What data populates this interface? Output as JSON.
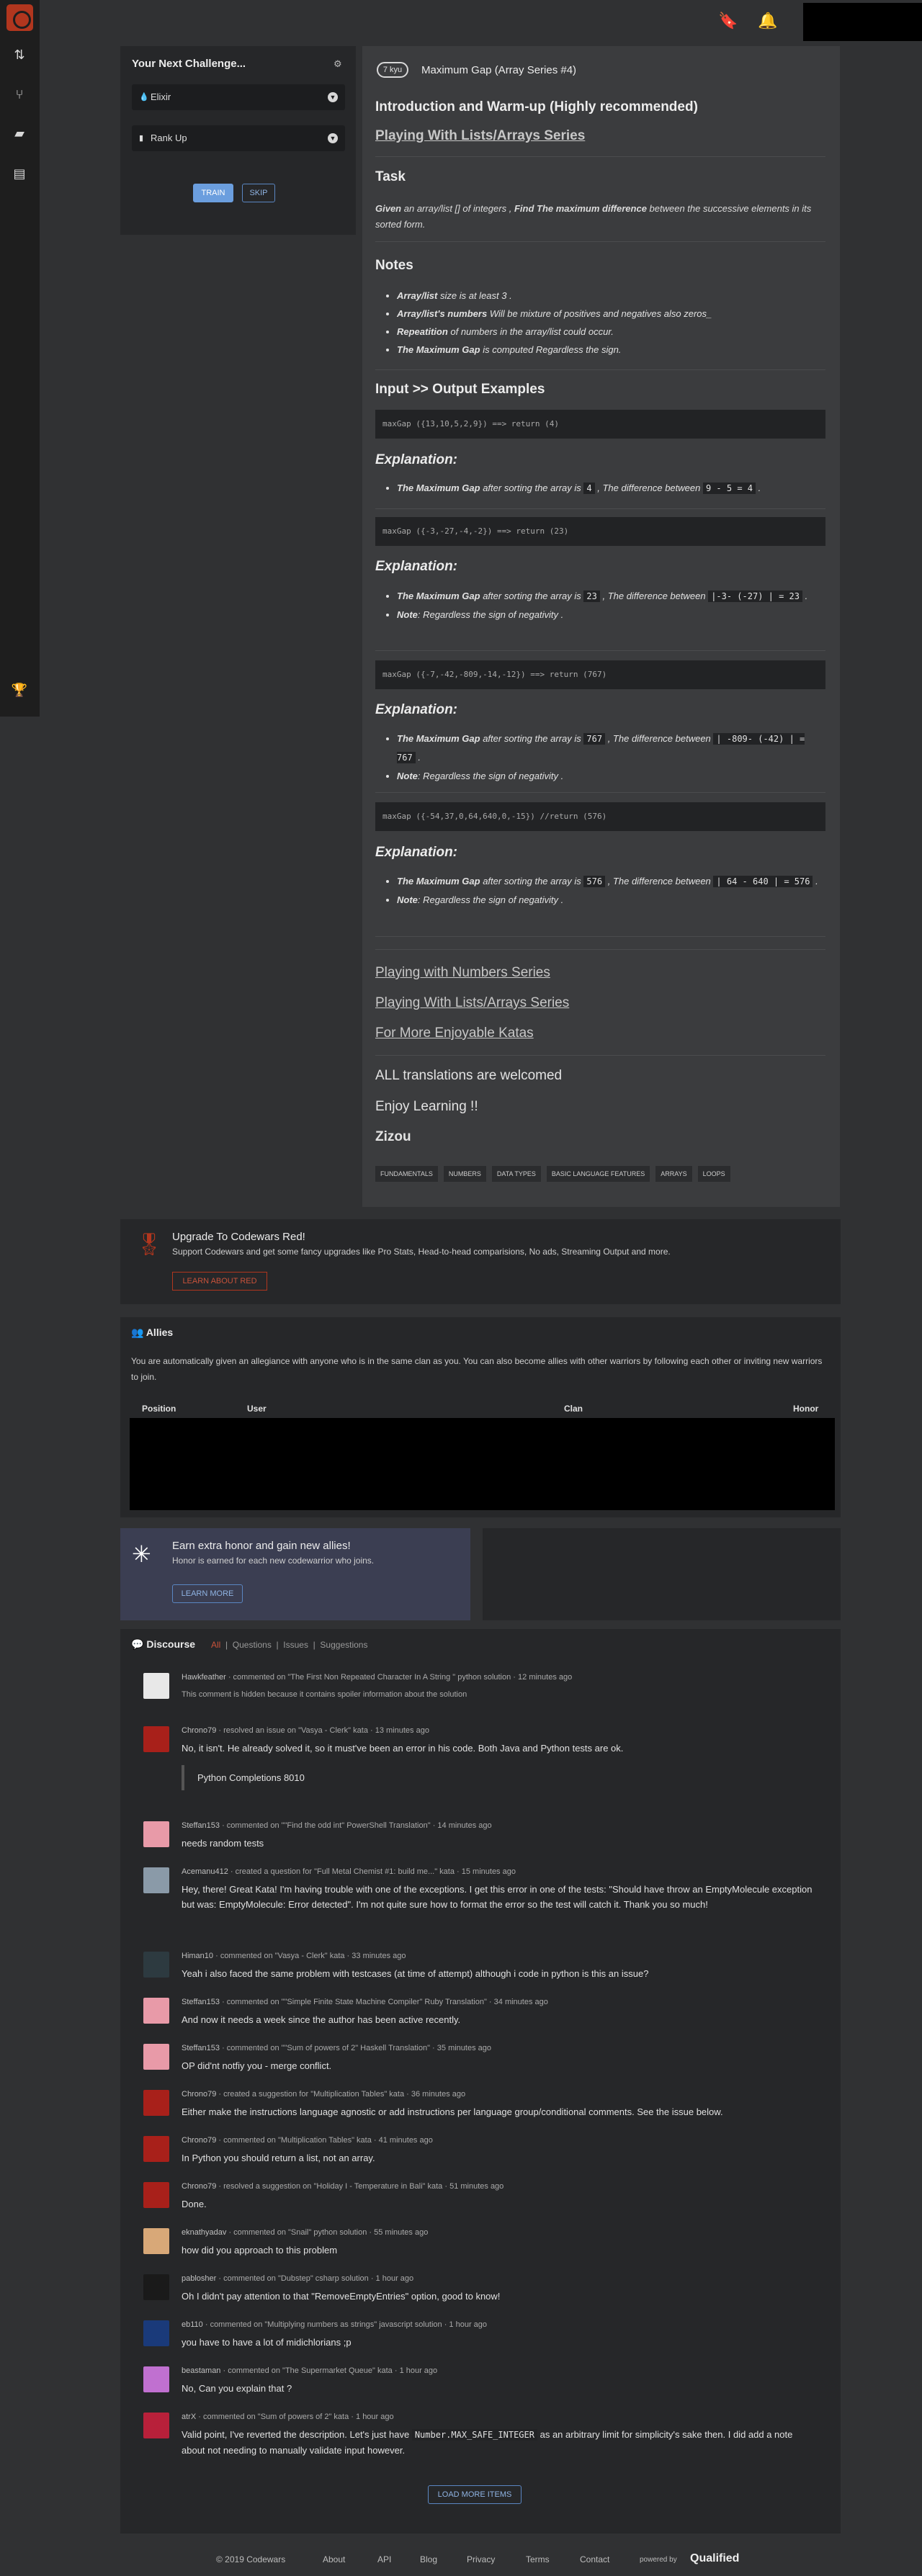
{
  "sidebar": {
    "icons": [
      "codewars-logo",
      "practice-icon",
      "kata-icon",
      "discuss-icon",
      "docs-icon",
      "leaderboard-icon"
    ]
  },
  "header": {
    "icons": [
      "bookmark-icon",
      "bell-icon"
    ]
  },
  "challenge": {
    "title": "Your Next Challenge...",
    "language": "Elixir",
    "mode": "Rank Up",
    "train": "TRAIN",
    "skip": "SKIP"
  },
  "kata": {
    "rank": "7 kyu",
    "name": "Maximum Gap (Array Series #4)",
    "intro": "Introduction and Warm-up (Highly recommended)",
    "series_link": "Playing With Lists/Arrays Series",
    "task_h": "Task",
    "task_pre": "Given",
    "task_mid": "an array/list [] of integers ,",
    "task_bold": "Find The maximum difference",
    "task_post": "between the successive elements in its sorted form.",
    "notes_h": "Notes",
    "notes": [
      {
        "b": "Array/list",
        "t": "size is at least 3 ."
      },
      {
        "b": "Array/list's numbers",
        "t": "Will be mixture of positives and negatives also zeros_"
      },
      {
        "b": "Repeatition",
        "t": "of numbers in the array/list could occur."
      },
      {
        "b": "The Maximum Gap",
        "t": "is computed Regardless the sign."
      }
    ],
    "io_h": "Input >> Output Examples",
    "examples": [
      {
        "code": "maxGap ({13,10,5,2,9}) ==> return (4)",
        "exp": "Explanation:",
        "b": "The Maximum Gap",
        "t1": "after sorting the array is",
        "v": "4",
        "t2": ", The difference between",
        "d": "9 - 5 = 4",
        "t3": ".",
        "note": null
      },
      {
        "code": "maxGap ({-3,-27,-4,-2}) ==> return (23)",
        "exp": "Explanation:",
        "b": "The Maximum Gap",
        "t1": "after sorting the array is",
        "v": "23",
        "t2": ", The difference between",
        "d": "|-3- (-27) | = 23",
        "t3": ".",
        "note": "Regardless the sign of negativity ."
      },
      {
        "code": "maxGap ({-7,-42,-809,-14,-12}) ==> return (767)",
        "exp": "Explanation:",
        "b": "The Maximum Gap",
        "t1": "after sorting the array is",
        "v": "767",
        "t2": ", The difference between",
        "d": "| -809- (-42) | = 767",
        "t3": ".",
        "note": "Regardless the sign of negativity ."
      },
      {
        "code": "maxGap ({-54,37,0,64,640,0,-15}) //return (576)",
        "exp": "Explanation:",
        "b": "The Maximum Gap",
        "t1": "after sorting the array is",
        "v": "576",
        "t2": ", The difference between",
        "d": "| 64 - 640 | = 576",
        "t3": ".",
        "note": "Regardless the sign of negativity ."
      }
    ],
    "note_label": "Note",
    "links": [
      "Playing with Numbers Series",
      "Playing With Lists/Arrays Series",
      "For More Enjoyable Katas"
    ],
    "translations": "ALL translations are welcomed",
    "enjoy": "Enjoy Learning !!",
    "author": "Zizou",
    "tags": [
      "FUNDAMENTALS",
      "NUMBERS",
      "DATA TYPES",
      "BASIC LANGUAGE FEATURES",
      "ARRAYS",
      "LOOPS"
    ]
  },
  "red": {
    "title": "Upgrade To Codewars Red!",
    "text": "Support Codewars and get some fancy upgrades like Pro Stats, Head-to-head comparisions, No ads, Streaming Output and more.",
    "button": "LEARN ABOUT RED"
  },
  "allies": {
    "title": "Allies",
    "text": "You are automatically given an allegiance with anyone who is in the same clan as you. You can also become allies with other warriors by following each other or inviting new warriors to join.",
    "columns": [
      "Position",
      "User",
      "Clan",
      "Honor"
    ]
  },
  "honor": {
    "title": "Earn extra honor and gain new allies!",
    "text": "Honor is earned for each new codewarrior who joins.",
    "button": "LEARN MORE"
  },
  "discourse": {
    "title": "Discourse",
    "tabs": [
      "All",
      "Questions",
      "Issues",
      "Suggestions"
    ],
    "more": "LOAD MORE ITEMS",
    "items": [
      {
        "user": "Hawkfeather",
        "action": "commented on",
        "target": "\"The First Non Repeated Character In A String \" python solution",
        "time": "12 minutes ago",
        "body": "This comment is hidden because it contains spoiler information about the solution",
        "color": "#e8e8e8"
      },
      {
        "user": "Chrono79",
        "action": "resolved an issue on",
        "target": "\"Vasya - Clerk\" kata",
        "time": "13 minutes ago",
        "body": "No, it isn't. He already solved it, so it must've been an error in his code. Both Java and Python tests are ok.",
        "quote": "Python Completions 8010",
        "color": "#a8201a"
      },
      {
        "user": "Steffan153",
        "action": "commented on",
        "target": "\"\"Find the odd int\" PowerShell Translation\"",
        "time": "14 minutes ago",
        "body": "needs random tests",
        "color": "#e89aa8"
      },
      {
        "user": "Acemanu412",
        "action": "created a question for",
        "target": "\"Full Metal Chemist #1: build me...\" kata",
        "time": "15 minutes ago",
        "body": "Hey, there! Great Kata! I'm having trouble with one of the exceptions. I get this error in one of the tests: \"Should have throw an EmptyMolecule exception but was: EmptyMolecule: Error detected\". I'm not quite sure how to format the error so the test will catch it. Thank you so much!",
        "color": "#8a9aa8"
      },
      {
        "user": "Himan10",
        "action": "commented on",
        "target": "\"Vasya - Clerk\" kata",
        "time": "33 minutes ago",
        "body": "Yeah i also faced the same problem with testcases (at time of attempt) although i code in python is this an issue?",
        "color": "#2d3a40"
      },
      {
        "user": "Steffan153",
        "action": "commented on",
        "target": "\"\"Simple Finite State Machine Compiler\" Ruby Translation\"",
        "time": "34 minutes ago",
        "body": "And now it needs a week since the author has been active recently.",
        "color": "#e89aa8"
      },
      {
        "user": "Steffan153",
        "action": "commented on",
        "target": "\"\"Sum of powers of 2\" Haskell Translation\"",
        "time": "35 minutes ago",
        "body": "OP did'nt notfiy you - merge conflict.",
        "color": "#e89aa8"
      },
      {
        "user": "Chrono79",
        "action": "created a suggestion for",
        "target": "\"Multiplication Tables\" kata",
        "time": "36 minutes ago",
        "body": "Either make the instructions language agnostic or add instructions per language group/conditional comments. See the issue below.",
        "color": "#a8201a"
      },
      {
        "user": "Chrono79",
        "action": "commented on",
        "target": "\"Multiplication Tables\" kata",
        "time": "41 minutes ago",
        "body": "In Python you should return a list, not an array.",
        "color": "#a8201a"
      },
      {
        "user": "Chrono79",
        "action": "resolved a suggestion on",
        "target": "\"Holiday I - Temperature in Bali\" kata",
        "time": "51 minutes ago",
        "body": "Done.",
        "color": "#a8201a"
      },
      {
        "user": "eknathyadav",
        "action": "commented on",
        "target": "\"Snail\" python solution",
        "time": "55 minutes ago",
        "body": "how did you approach to this problem",
        "color": "#d8a878"
      },
      {
        "user": "pablosher",
        "action": "commented on",
        "target": "\"Dubstep\" csharp solution",
        "time": "1 hour ago",
        "body": "Oh I didn't pay attention to that \"RemoveEmptyEntries\" option, good to know!",
        "color": "#1a1a1a"
      },
      {
        "user": "eb110",
        "action": "commented on",
        "target": "\"Multiplying numbers as strings\" javascript solution",
        "time": "1 hour ago",
        "body": "you have to have a lot of midichlorians ;p",
        "color": "#1a3a7a"
      },
      {
        "user": "beastaman",
        "action": "commented on",
        "target": "\"The Supermarket Queue\" kata",
        "time": "1 hour ago",
        "body": "No, Can you explain that ?",
        "color": "#c070d0"
      },
      {
        "user": "atrX",
        "action": "commented on",
        "target": "\"Sum of powers of 2\" kata",
        "time": "1 hour ago",
        "body": "Valid point, I've reverted the description. Let's just have",
        "code": "Number.MAX_SAFE_INTEGER",
        "body2": "as an arbitrary limit for simplicity's sake then. I did add a note about not needing to manually validate input however.",
        "color": "#b8203a"
      }
    ]
  },
  "footer": {
    "copyright": "© 2019 Codewars",
    "links": [
      "About",
      "API",
      "Blog",
      "Privacy",
      "Terms",
      "Contact"
    ],
    "powered": "powered by",
    "brand": "Qualified"
  }
}
